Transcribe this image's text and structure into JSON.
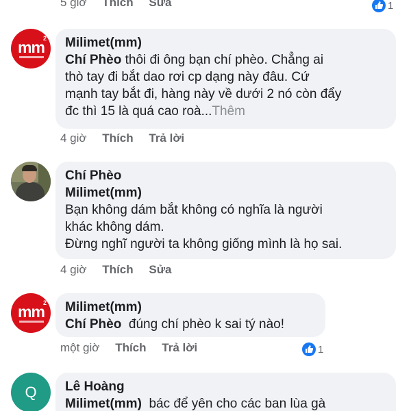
{
  "top_actions": {
    "time": "5 giờ",
    "like": "Thích",
    "edit": "Sửa",
    "reactions": "1"
  },
  "comments": [
    {
      "author": "Milimet(mm)",
      "mention": "Chí Phèo",
      "text_line1": " thôi đi ông bạn chí phèo. Chẳng ai",
      "text_line2": "thò tay đi bắt dao rơi cp dạng này đâu. Cứ",
      "text_line3": "mạnh tay bắt đi, hàng này về dưới 2 nó còn đẩy",
      "text_line4": "đc thì 15 là quá cao roà...",
      "more": "Thêm",
      "time": "4 giờ",
      "like": "Thích",
      "reply": "Trả lời"
    },
    {
      "author": "Chí Phèo",
      "mention": "Milimet(mm)",
      "text_line1": "Bạn không dám bắt không có nghĩa là người",
      "text_line2": "khác không dám.",
      "text_line3": "Đừng nghĩ người ta không giống mình là họ sai.",
      "time": "4 giờ",
      "like": "Thích",
      "edit": "Sửa"
    },
    {
      "author": "Milimet(mm)",
      "mention": "Chí Phèo",
      "text": "  đúng chí phèo k sai tý nào!",
      "time": "một giờ",
      "like": "Thích",
      "reply": "Trả lời",
      "reactions": "1"
    },
    {
      "author": "Lê Hoàng",
      "avatar_letter": "Q",
      "mention": "Milimet(mm)",
      "text": "  bác để yên cho các ban lùa gà"
    }
  ],
  "avatar_logo_text": "mm",
  "avatar_logo_sup": "2",
  "colors": {
    "like_blue": "#1877f2",
    "bubble": "#f0f2f5",
    "mm_red": "#d8101a",
    "teal": "#1f9b86"
  }
}
